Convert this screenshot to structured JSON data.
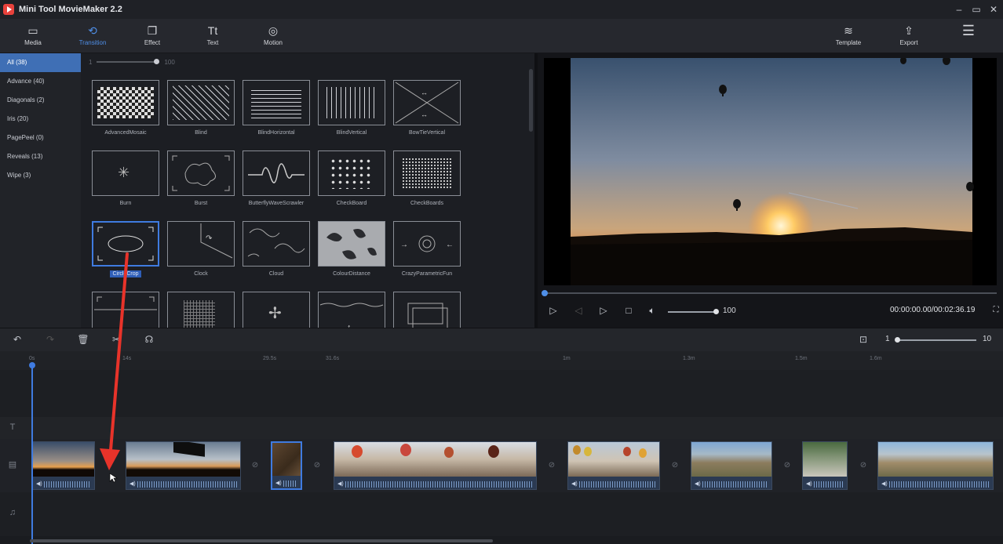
{
  "window": {
    "title": "Mini Tool MovieMaker 2.2"
  },
  "toolbar": {
    "media": "Media",
    "transition": "Transition",
    "effect": "Effect",
    "text": "Text",
    "motion": "Motion",
    "template": "Template",
    "export": "Export"
  },
  "categories": [
    "All (38)",
    "Advance (40)",
    "Diagonals (2)",
    "Iris (20)",
    "PagePeel (0)",
    "Reveals (13)",
    "Wipe (3)"
  ],
  "grid": {
    "zoom_min": "1",
    "zoom_max": "100",
    "tiles": [
      "AdvancedMosaic",
      "Blind",
      "BlindHorizontal",
      "BlindVertical",
      "BowTieVertical",
      "Burn",
      "Burst",
      "ButterflyWaveScrawler",
      "CheckBoard",
      "CheckBoards",
      "CircleCrop",
      "Clock",
      "Cloud",
      "ColourDistance",
      "CrazyParametricFun",
      "",
      "",
      "",
      "",
      ""
    ]
  },
  "player": {
    "volume": "100",
    "timecode": "00:00:00.00/00:02:36.19"
  },
  "timeline": {
    "zoom_min": "1",
    "zoom_max": "10",
    "ticks": [
      "0s",
      "14s",
      "29.5s",
      "31.6s",
      "1m",
      "1.3m",
      "1.5m",
      "1.6m"
    ]
  },
  "colors": {
    "accent": "#3f7be0",
    "annotation_arrow": "#e8332a"
  }
}
